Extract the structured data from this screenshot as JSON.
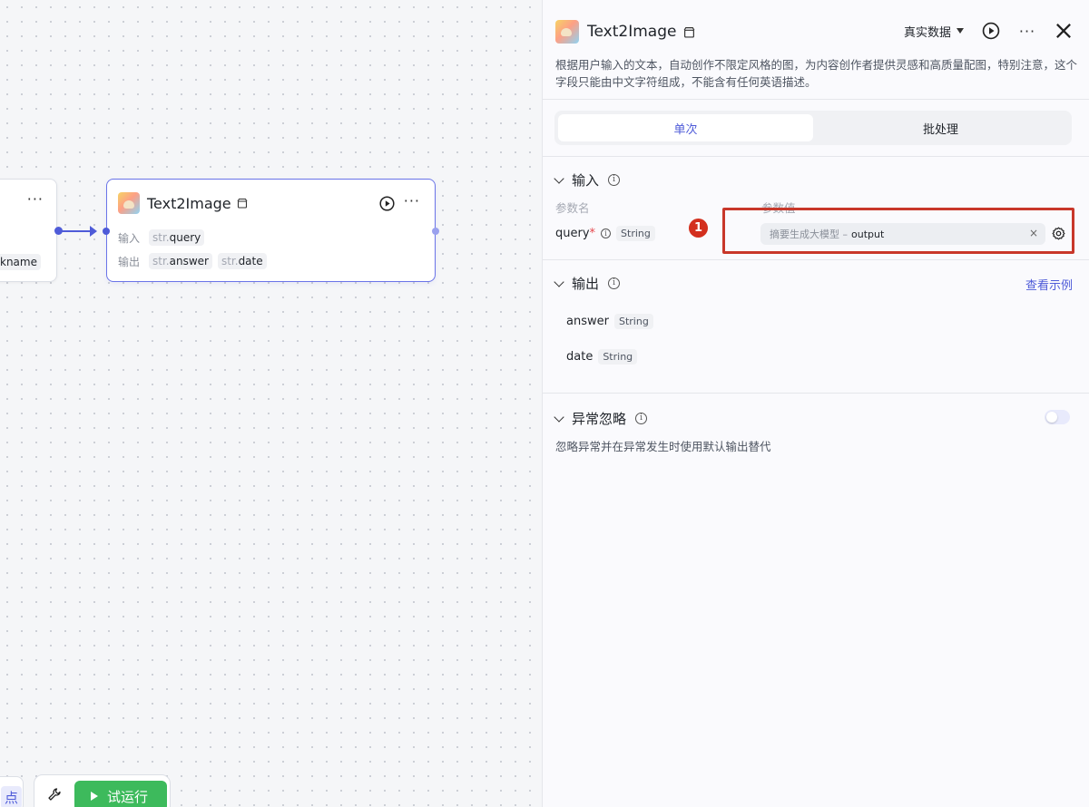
{
  "canvas": {
    "left_node": {
      "tag_text": "kname"
    },
    "main_node": {
      "title": "Text2Image",
      "input_label": "输入",
      "output_label": "输出",
      "inputs": [
        {
          "prefix": "str.",
          "name": "query"
        }
      ],
      "outputs": [
        {
          "prefix": "str.",
          "name": "answer"
        },
        {
          "prefix": "str.",
          "name": "date"
        }
      ]
    },
    "bottom": {
      "left_btn_text": "点",
      "run_label": "试运行"
    }
  },
  "panel": {
    "title": "Text2Image",
    "data_select": "真实数据",
    "description": "根据用户输入的文本，自动创作不限定风格的图，为内容创作者提供灵感和高质量配图，特别注意，这个字段只能由中文字符组成，不能含有任何英语描述。",
    "tabs": [
      {
        "label": "单次"
      },
      {
        "label": "批处理"
      }
    ],
    "input_section": {
      "title": "输入",
      "col_name": "参数名",
      "col_value": "参数值",
      "param_name": "query",
      "required_mark": "*",
      "param_type": "String",
      "value_source": "摘要生成大模型 –",
      "value_field": "output",
      "clear_glyph": "×"
    },
    "annotation_number": "1",
    "output_section": {
      "title": "输出",
      "view_example": "查看示例",
      "outputs": [
        {
          "name": "answer",
          "type": "String"
        },
        {
          "name": "date",
          "type": "String"
        }
      ]
    },
    "ignore_section": {
      "title": "异常忽略",
      "description": "忽略异常并在异常发生时使用默认输出替代",
      "enabled": false
    }
  },
  "colors": {
    "accent": "#4e5bd8",
    "run_green": "#3dba5c",
    "highlight_red": "#c8372a"
  }
}
